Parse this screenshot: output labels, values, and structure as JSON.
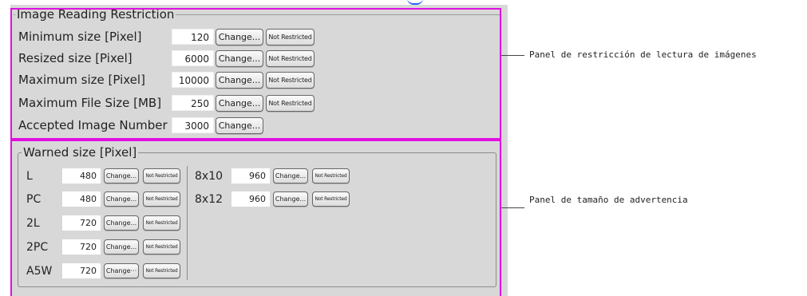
{
  "restriction_panel": {
    "title": "Image Reading Restriction",
    "rows": [
      {
        "label": "Minimum size [Pixel]",
        "value": "120",
        "change": "Change...",
        "not_restricted": "Not Restricted"
      },
      {
        "label": "Resized size [Pixel]",
        "value": "6000",
        "change": "Change...",
        "not_restricted": "Not Restricted"
      },
      {
        "label": "Maximum size [Pixel]",
        "value": "10000",
        "change": "Change...",
        "not_restricted": "Not Restricted"
      },
      {
        "label": "Maximum File Size [MB]",
        "value": "250",
        "change": "Change...",
        "not_restricted": "Not Restricted"
      },
      {
        "label": "Accepted Image Number",
        "value": "3000",
        "change": "Change..."
      }
    ]
  },
  "warned_panel": {
    "title": "Warned size [Pixel]",
    "left_rows": [
      {
        "label": "L",
        "value": "480",
        "change": "Change...",
        "not_restricted": "Not Restricted"
      },
      {
        "label": "PC",
        "value": "480",
        "change": "Change...",
        "not_restricted": "Not Restricted"
      },
      {
        "label": "2L",
        "value": "720",
        "change": "Change...",
        "not_restricted": "Not Restricted"
      },
      {
        "label": "2PC",
        "value": "720",
        "change": "Change...",
        "not_restricted": "Not Restricted"
      },
      {
        "label": "A5W",
        "value": "720",
        "change": "Change···",
        "not_restricted": "Not Restricted"
      }
    ],
    "right_rows": [
      {
        "label": "8x10",
        "value": "960",
        "change": "Change...",
        "not_restricted": "Not Restricted"
      },
      {
        "label": "8x12",
        "value": "960",
        "change": "Change...",
        "not_restricted": "Not Restricted"
      }
    ]
  },
  "callouts": {
    "restriction": "Panel de restricción de lectura de imágenes",
    "warned": "Panel de tamaño de advertencia"
  },
  "colors": {
    "highlight": "#e010e0",
    "panel_bg": "#d8d8d8"
  }
}
